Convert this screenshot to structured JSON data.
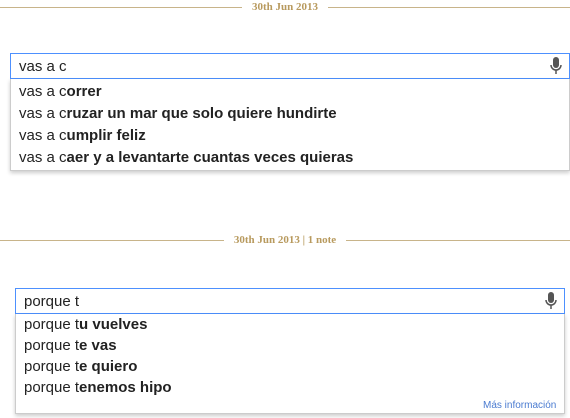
{
  "post1": {
    "date": "30th Jun 2013",
    "query": "vas a c",
    "suggestions": [
      {
        "typed": "vas a c",
        "rest": "orrer"
      },
      {
        "typed": "vas a c",
        "rest": "ruzar un mar que solo quiere hundirte"
      },
      {
        "typed": "vas a c",
        "rest": "umplir feliz"
      },
      {
        "typed": "vas a c",
        "rest": "aer y a levantarte cuantas veces quieras"
      }
    ]
  },
  "post2": {
    "date": "30th Jun 2013 | 1 note",
    "query": "porque t",
    "suggestions": [
      {
        "typed": "porque t",
        "rest": "u vuelves"
      },
      {
        "typed": "porque t",
        "rest": "e vas"
      },
      {
        "typed": "porque t",
        "rest": "e quiero"
      },
      {
        "typed": "porque t",
        "rest": "enemos hipo"
      }
    ],
    "more_link": "Más información"
  },
  "icons": {
    "mic": "microphone-icon"
  },
  "colors": {
    "divider": "#c8b48a",
    "date": "#b89a5e",
    "focus_border": "#4d90fe",
    "link": "#4a7bd0"
  }
}
